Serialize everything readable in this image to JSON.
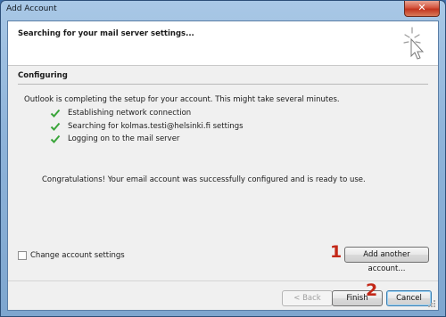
{
  "window": {
    "title": "Add Account",
    "close_symbol": "✕"
  },
  "header": {
    "title": "Searching for your mail server settings...",
    "icon": "pointer-cursor-sparkle-icon"
  },
  "section": {
    "title": "Configuring",
    "intro": "Outlook is completing the setup for your account. This might take several minutes."
  },
  "steps": [
    {
      "label": "Establishing network connection",
      "status": "done"
    },
    {
      "label": "Searching for kolmas.testi@helsinki.fi settings",
      "status": "done"
    },
    {
      "label": "Logging on to the mail server",
      "status": "done"
    }
  ],
  "message": "Congratulations! Your email account was successfully configured and is ready to use.",
  "options": {
    "change_settings_label": "Change account settings",
    "change_settings_checked": false
  },
  "buttons": {
    "add_another": "Add another account...",
    "back": "< Back",
    "finish": "Finish",
    "cancel": "Cancel"
  },
  "annotations": {
    "marker_1": "1",
    "marker_2": "2"
  },
  "colors": {
    "check": "#3aa53a",
    "annotation": "#c32818"
  }
}
